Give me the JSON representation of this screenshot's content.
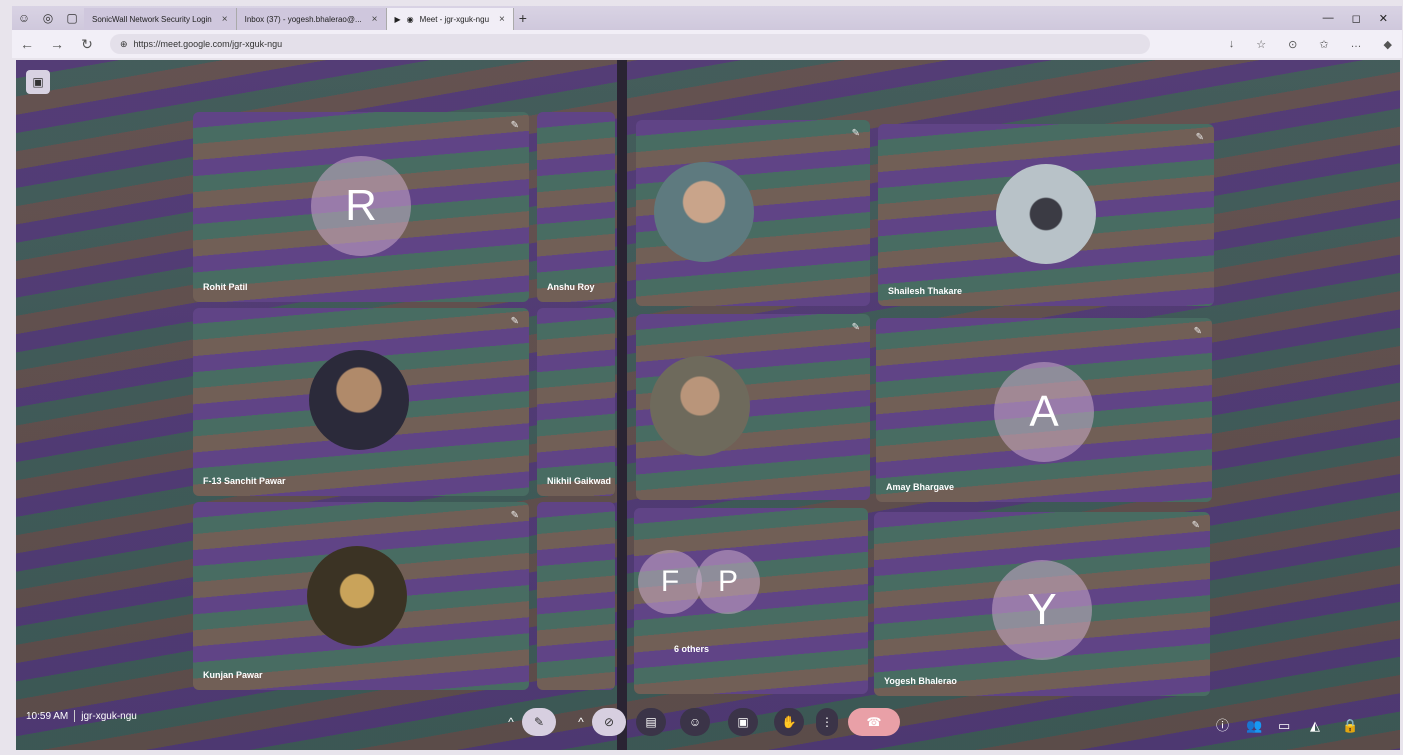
{
  "browser": {
    "tabs": [
      {
        "label": "SonicWall Network Security Login",
        "active": false
      },
      {
        "label": "Inbox (37) - yogesh.bhalerao@...",
        "active": false
      },
      {
        "label": "Meet - jgr-xguk-ngu",
        "active": true
      }
    ],
    "url": "https://meet.google.com/jgr-xguk-ngu"
  },
  "meet": {
    "participants": [
      {
        "name": "Rohit Patil",
        "avatar_letter": "R"
      },
      {
        "name": "Anshu Roy",
        "avatar_letter": ""
      },
      {
        "name": "",
        "avatar_letter": ""
      },
      {
        "name": "Shailesh Thakare",
        "avatar_letter": ""
      },
      {
        "name": "F-13 Sanchit Pawar",
        "avatar_letter": ""
      },
      {
        "name": "Nikhil Gaikwad",
        "avatar_letter": ""
      },
      {
        "name": "",
        "avatar_letter": ""
      },
      {
        "name": "Amay Bhargave",
        "avatar_letter": "A"
      },
      {
        "name": "Kunjan Pawar",
        "avatar_letter": ""
      },
      {
        "name": "6 others",
        "avatar_letter": "F"
      },
      {
        "name": "Yogesh Bhalerao",
        "avatar_letter": "Y"
      }
    ],
    "others_letters": [
      "F",
      "P"
    ],
    "time": "10:59 AM",
    "meeting_code": "jgr-xguk-ngu"
  },
  "colors": {
    "leave_button": "#e9a0a7",
    "control_bg": "#3b3448"
  }
}
